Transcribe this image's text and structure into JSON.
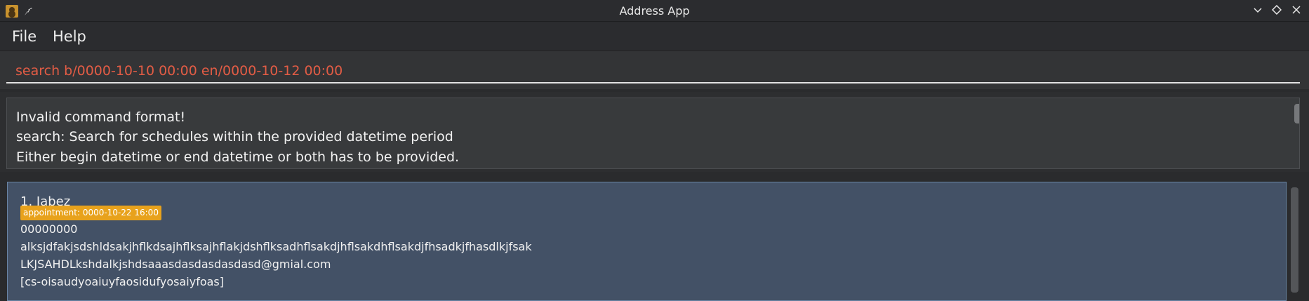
{
  "window": {
    "title": "Address App",
    "icons": [
      "app-icon",
      "pin-icon",
      "minimize-icon",
      "maximize-icon",
      "close-icon"
    ],
    "minimize_glyph": "⌄",
    "maximize_glyph": "◇",
    "close_glyph": "✕",
    "pin_glyph": "📌"
  },
  "menu": {
    "file": "File",
    "help": "Help"
  },
  "command": {
    "value": "search b/0000-10-10 00:00 en/0000-10-12 00:00",
    "color": "#e25c45"
  },
  "result": {
    "lines": [
      "Invalid command format!",
      "search: Search for schedules within the provided datetime period",
      "Either begin datetime or end datetime or both has to be provided."
    ]
  },
  "persons": [
    {
      "index_name": "1. Jabez",
      "appointment": "appointment: 0000-10-22 16:00",
      "phone": "00000000",
      "address": "alksjdfakjsdshldsakjhflkdsajhflksajhflakjdshflksadhflsakdjhflsakdhflsakdjfhsadkjfhasdlkjfsak",
      "email": "LKJSAHDLkshdalkjshdsaaasdasdasdasdasd@gmial.com",
      "tag": "[cs-oisaudyoaiuyfaosidufyosaiyfoas]"
    }
  ],
  "colors": {
    "card_background": "#435166",
    "appointment_tag": "#e8a21c",
    "window_background": "#2a2b2d"
  }
}
